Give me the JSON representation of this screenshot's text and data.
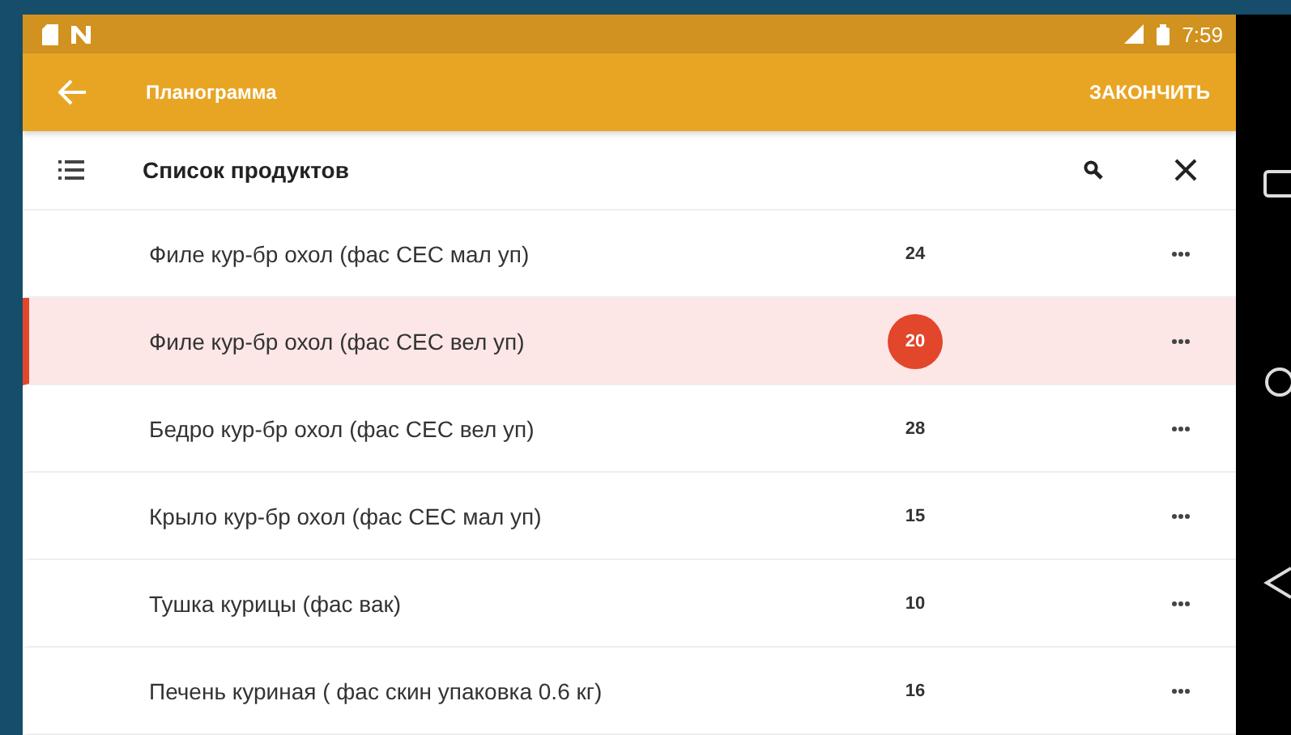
{
  "status_bar": {
    "time": "7:59"
  },
  "app_bar": {
    "title": "Планограмма",
    "action": "ЗАКОНЧИТЬ"
  },
  "toolbar": {
    "title": "Список продуктов"
  },
  "rows": [
    {
      "name": "Филе кур-бр охол (фас СЕС мал уп)",
      "quantity": "24",
      "selected": false
    },
    {
      "name": "Филе кур-бр охол (фас СЕС вел уп)",
      "quantity": "20",
      "selected": true
    },
    {
      "name": "Бедро кур-бр охол (фас СЕС вел уп)",
      "quantity": "28",
      "selected": false
    },
    {
      "name": "Крыло кур-бр охол (фас СЕС мал уп)",
      "quantity": "15",
      "selected": false
    },
    {
      "name": "Тушка курицы (фас вак)",
      "quantity": "10",
      "selected": false
    },
    {
      "name": "Печень куриная ( фас скин упаковка 0.6 кг)",
      "quantity": "16",
      "selected": false
    }
  ]
}
